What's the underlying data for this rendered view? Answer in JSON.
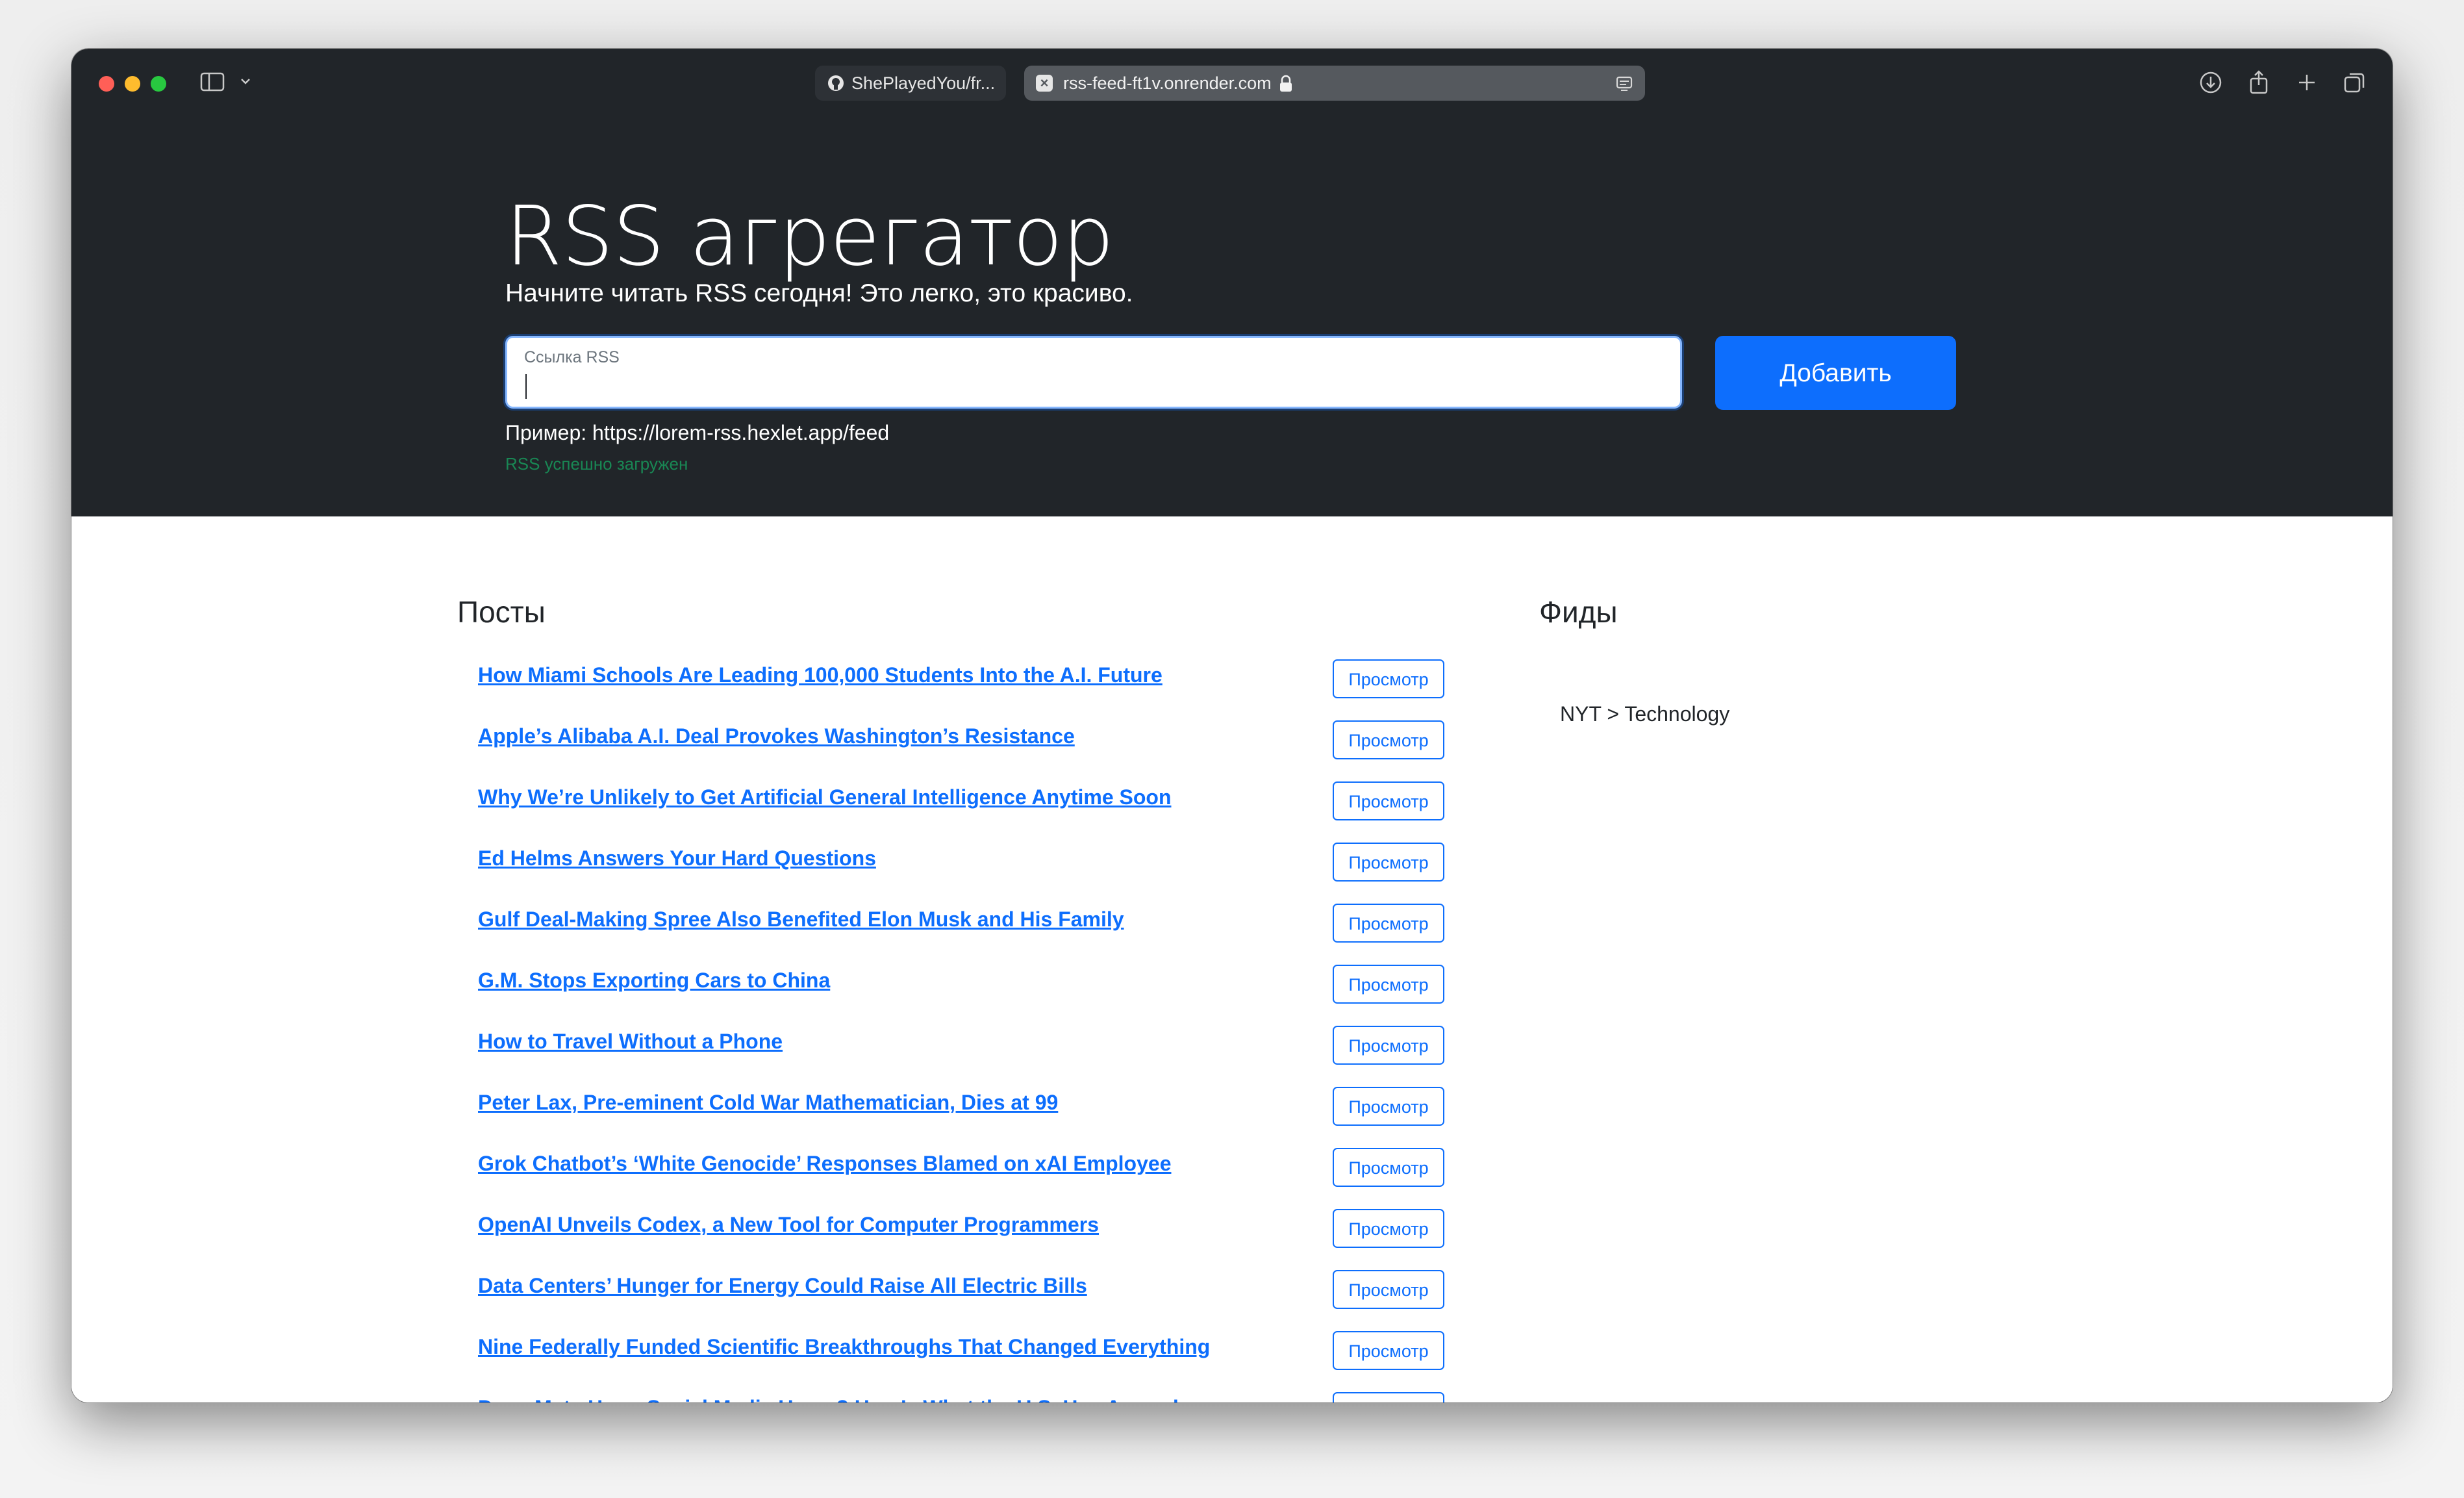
{
  "browser": {
    "tabs": [
      {
        "title": "ShePlayedYou/fr...",
        "active": false
      },
      {
        "title": "rss-feed-ft1v.onrender.com",
        "active": true
      }
    ]
  },
  "hero": {
    "title": "RSS агрегатор",
    "lead": "Начните читать RSS сегодня! Это легко, это красиво.",
    "input_label": "Ссылка RSS",
    "input_value": "",
    "add_button": "Добавить",
    "example": "Пример: https://lorem-rss.hexlet.app/feed",
    "feedback": "RSS успешно загружен"
  },
  "posts": {
    "title": "Посты",
    "view_label": "Просмотр",
    "items": [
      {
        "title": "How Miami Schools Are Leading 100,000 Students Into the A.I. Future"
      },
      {
        "title": "Apple’s Alibaba A.I. Deal Provokes Washington’s Resistance"
      },
      {
        "title": "Why We’re Unlikely to Get Artificial General Intelligence Anytime Soon"
      },
      {
        "title": "Ed Helms Answers Your Hard Questions"
      },
      {
        "title": "Gulf Deal-Making Spree Also Benefited Elon Musk and His Family"
      },
      {
        "title": "G.M. Stops Exporting Cars to China"
      },
      {
        "title": "How to Travel Without a Phone"
      },
      {
        "title": "Peter Lax, Pre-eminent Cold War Mathematician, Dies at 99"
      },
      {
        "title": "Grok Chatbot’s ‘White Genocide’ Responses Blamed on xAI Employee"
      },
      {
        "title": "OpenAI Unveils Codex, a New Tool for Computer Programmers"
      },
      {
        "title": "Data Centers’ Hunger for Energy Could Raise All Electric Bills"
      },
      {
        "title": "Nine Federally Funded Scientific Breakthroughs That Changed Everything"
      },
      {
        "title": "Does Meta Harm Social Media Users? Here’s What the U.S. Has Argued"
      }
    ]
  },
  "feeds": {
    "title": "Фиды",
    "items": [
      {
        "title": "NYT > Technology"
      }
    ]
  },
  "colors": {
    "primary": "#0d6efd",
    "dark": "#212529",
    "success": "#198754"
  }
}
